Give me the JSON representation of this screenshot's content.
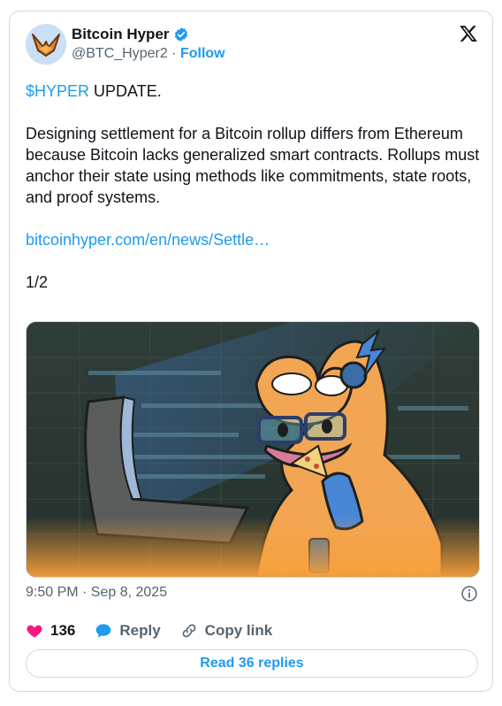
{
  "author": {
    "name": "Bitcoin Hyper",
    "handle": "@BTC_Hyper2",
    "separator": "·",
    "follow_label": "Follow",
    "verified": true,
    "avatar_icon": "orange-bird-logo"
  },
  "tweet": {
    "cashtag": "$HYPER",
    "headline_rest": " UPDATE.",
    "paragraph": "Designing settlement for a Bitcoin rollup differs from Ethereum because Bitcoin lacks generalized smart contracts. Rollups must anchor their state using methods like commitments, state roots, and proof systems.",
    "link": "bitcoinhyper.com/en/news/Settle…",
    "thread_count": "1/2"
  },
  "meta": {
    "timestamp": "9:50 PM · Sep 8, 2025"
  },
  "actions": {
    "likes": "136",
    "reply_label": "Reply",
    "copy_link_label": "Copy link"
  },
  "read_replies_label": "Read 36 replies",
  "colors": {
    "accent": "#1d9bf0",
    "like": "#f91880",
    "text": "#0f1419",
    "muted": "#536471",
    "border": "#cfd9de"
  }
}
